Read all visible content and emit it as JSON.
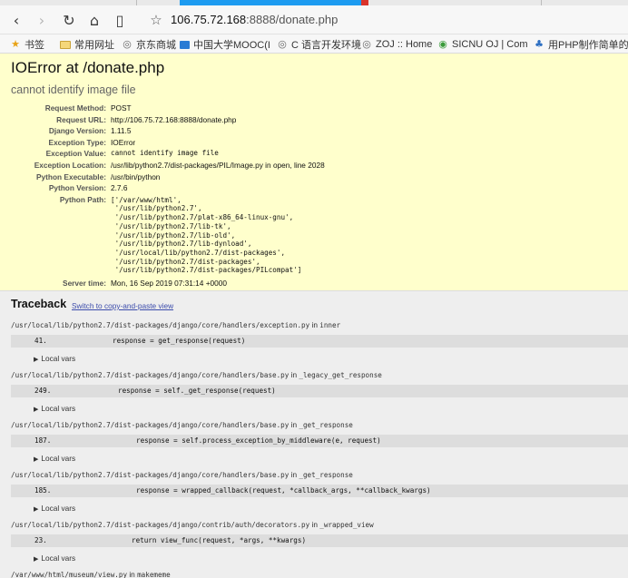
{
  "browser": {
    "url_host": "106.75.72.168",
    "url_rest": ":8888/donate.php",
    "bookmarks": [
      {
        "label": "书签",
        "icon": "star-icon"
      },
      {
        "label": "常用网址",
        "icon": "folder-icon"
      },
      {
        "label": "京东商城",
        "icon": "globe-icon"
      },
      {
        "label": "中国大学MOOC(I",
        "icon": "mooc-icon"
      },
      {
        "label": "C 语言开发环境",
        "icon": "globe-icon"
      },
      {
        "label": "ZOJ :: Home",
        "icon": "globe-icon"
      },
      {
        "label": "SICNU OJ | Com",
        "icon": "sicnu-icon"
      },
      {
        "label": "用PHP制作简单的",
        "icon": "php-icon"
      }
    ]
  },
  "error": {
    "title": "IOError at /donate.php",
    "subtitle": "cannot identify image file",
    "meta": [
      {
        "key": "Request Method:",
        "value": "POST"
      },
      {
        "key": "Request URL:",
        "value": "http://106.75.72.168:8888/donate.php"
      },
      {
        "key": "Django Version:",
        "value": "1.11.5"
      },
      {
        "key": "Exception Type:",
        "value": "IOError"
      },
      {
        "key": "Exception Value:",
        "value": "cannot identify image file"
      },
      {
        "key": "Exception Location:",
        "value": "/usr/lib/python2.7/dist-packages/PIL/Image.py in open, line 2028"
      },
      {
        "key": "Python Executable:",
        "value": "/usr/bin/python"
      },
      {
        "key": "Python Version:",
        "value": "2.7.6"
      },
      {
        "key": "Python Path:",
        "value": ""
      }
    ],
    "python_path": "['/var/www/html',\n '/usr/lib/python2.7',\n '/usr/lib/python2.7/plat-x86_64-linux-gnu',\n '/usr/lib/python2.7/lib-tk',\n '/usr/lib/python2.7/lib-old',\n '/usr/lib/python2.7/lib-dynload',\n '/usr/local/lib/python2.7/dist-packages',\n '/usr/lib/python2.7/dist-packages',\n '/usr/lib/python2.7/dist-packages/PILcompat']",
    "server_time_key": "Server time:",
    "server_time": "Mon, 16 Sep 2019 07:31:14 +0000"
  },
  "traceback": {
    "title": "Traceback",
    "switch_label": "Switch to copy-and-paste view",
    "in_word": "in",
    "local_vars_label": "Local vars",
    "frames": [
      {
        "path": "/usr/local/lib/python2.7/dist-packages/django/core/handlers/exception.py",
        "func": "inner",
        "lineno": "41.",
        "code": "response = get_response(request)"
      },
      {
        "path": "/usr/local/lib/python2.7/dist-packages/django/core/handlers/base.py",
        "func": "_legacy_get_response",
        "lineno": "249.",
        "code": "response = self._get_response(request)"
      },
      {
        "path": "/usr/local/lib/python2.7/dist-packages/django/core/handlers/base.py",
        "func": "_get_response",
        "lineno": "187.",
        "code": "response = self.process_exception_by_middleware(e, request)"
      },
      {
        "path": "/usr/local/lib/python2.7/dist-packages/django/core/handlers/base.py",
        "func": "_get_response",
        "lineno": "185.",
        "code": "response = wrapped_callback(request, *callback_args, **callback_kwargs)"
      },
      {
        "path": "/usr/local/lib/python2.7/dist-packages/django/contrib/auth/decorators.py",
        "func": "_wrapped_view",
        "lineno": "23.",
        "code": "return view_func(request, *args, **kwargs)"
      },
      {
        "path": "/var/www/html/museum/view.py",
        "func": "makememe",
        "lineno": "",
        "code": ""
      }
    ]
  }
}
